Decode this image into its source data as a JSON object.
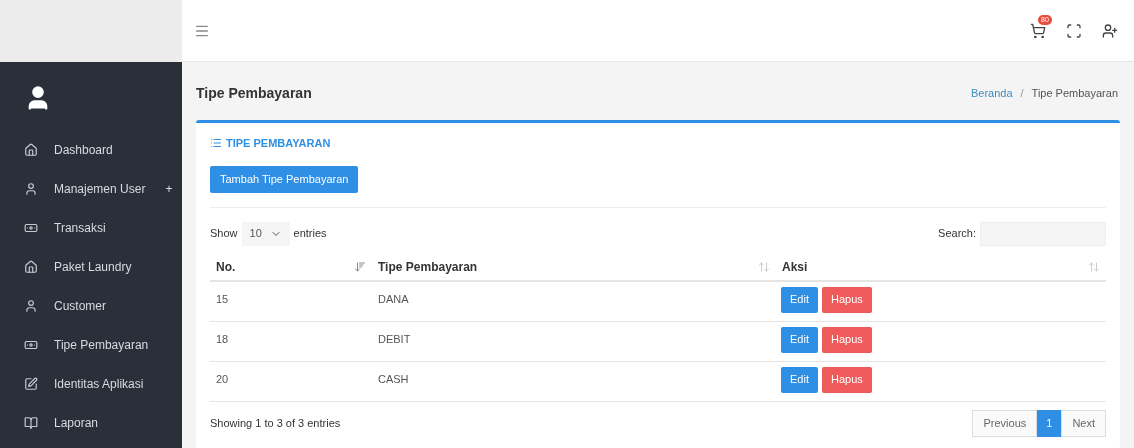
{
  "navbar": {
    "cart_badge": "80"
  },
  "sidebar": {
    "items": [
      {
        "label": "Dashboard",
        "kind": "home"
      },
      {
        "label": "Manajemen User",
        "kind": "user",
        "expand_symbol": "+"
      },
      {
        "label": "Transaksi",
        "kind": "money"
      },
      {
        "label": "Paket Laundry",
        "kind": "home"
      },
      {
        "label": "Customer",
        "kind": "user"
      },
      {
        "label": "Tipe Pembayaran",
        "kind": "money"
      },
      {
        "label": "Identitas Aplikasi",
        "kind": "edit"
      },
      {
        "label": "Laporan",
        "kind": "book"
      }
    ]
  },
  "page": {
    "title": "Tipe Pembayaran",
    "breadcrumb_separator": "/",
    "breadcrumb": [
      {
        "label": "Beranda",
        "link": true
      },
      {
        "label": "Tipe Pembayaran",
        "link": false
      }
    ]
  },
  "card": {
    "title": "TIPE PEMBAYARAN",
    "add_button": "Tambah Tipe Pembayaran",
    "length": {
      "before": "Show",
      "value": "10",
      "after": "entries"
    },
    "search_label": "Search:",
    "table": {
      "columns": [
        {
          "label": "No.",
          "sorted": true
        },
        {
          "label": "Tipe Pembayaran",
          "sorted": false
        },
        {
          "label": "Aksi",
          "sorted": false
        }
      ],
      "rows": [
        {
          "no": "15",
          "type": "DANA",
          "actions": [
            "Edit",
            "Hapus"
          ]
        },
        {
          "no": "18",
          "type": "DEBIT",
          "actions": [
            "Edit",
            "Hapus"
          ]
        },
        {
          "no": "20",
          "type": "CASH",
          "actions": [
            "Edit",
            "Hapus"
          ]
        }
      ]
    },
    "info": "Showing 1 to 3 of 3 entries",
    "pagination": {
      "previous": "Previous",
      "pages": [
        {
          "label": "1",
          "selected": true
        }
      ],
      "next": "Next"
    }
  }
}
